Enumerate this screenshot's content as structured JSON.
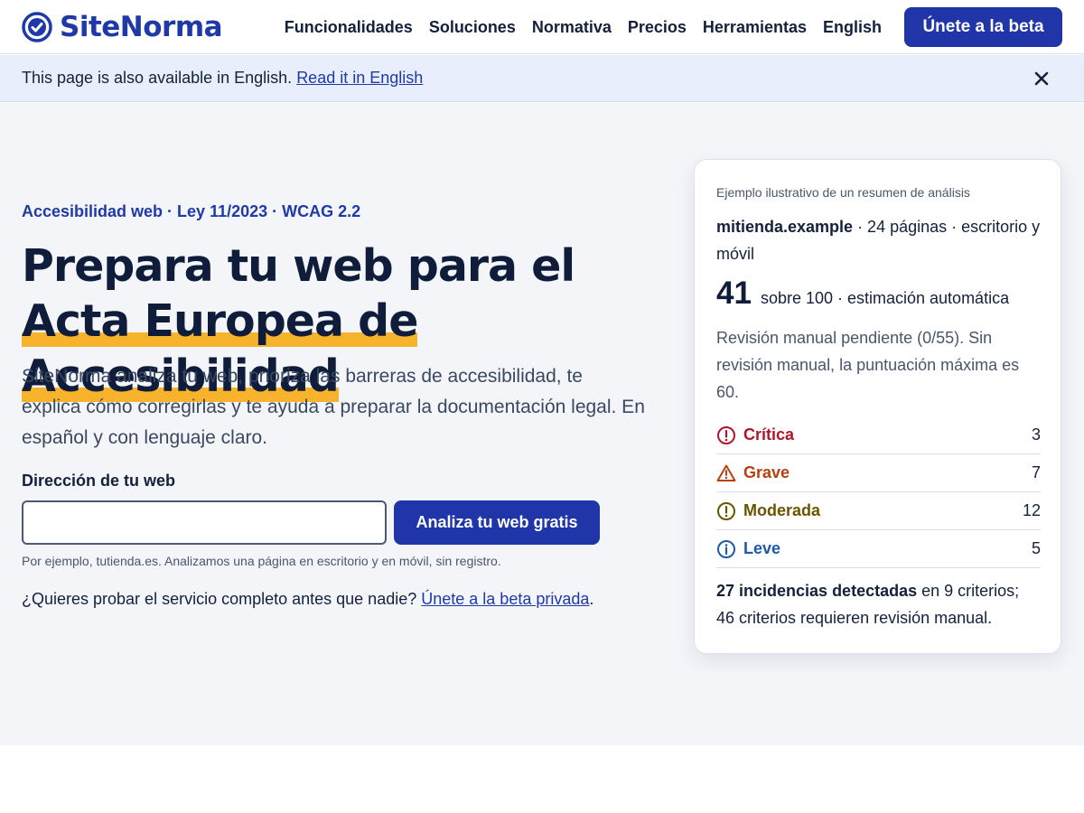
{
  "brand": {
    "name": "SiteNorma",
    "color": "#1f3aa8"
  },
  "nav": {
    "items": [
      "Funcionalidades",
      "Soluciones",
      "Normativa",
      "Precios",
      "Herramientas",
      "English"
    ],
    "cta": "Únete a la beta"
  },
  "banner": {
    "text": "This page is also available in English.",
    "link": "Read it in English",
    "close_icon": "close-icon"
  },
  "hero": {
    "eyebrow": "Accesibilidad web · Ley 11/2023 · WCAG 2.2",
    "headline_part1": "Prepara tu web para el ",
    "headline_highlight": "Acta Europea de Accesibilidad",
    "description": "SiteNorma analiza tu web, prioriza las barreras de accesibilidad, te explica cómo corregirlas y te ayuda a preparar la documentación legal. En español y con lenguaje claro.",
    "field_label": "Dirección de tu web",
    "input_value": "",
    "button": "Analiza tu web gratis",
    "hint": "Por ejemplo, tutienda.es. Analizamos una página en escritorio y en móvil, sin registro.",
    "cta_text": "¿Quieres probar el servicio completo antes que nadie? ",
    "cta_link": "Únete a la beta privada",
    "cta_end": "."
  },
  "card": {
    "caption": "Ejemplo ilustrativo de un resumen de análisis",
    "site": "mitienda.example",
    "site_meta": " · 24 páginas · escritorio y móvil",
    "score": "41",
    "score_rest": "sobre 100 · estimación automática",
    "note": "Revisión manual pendiente (0/55). Sin revisión manual, la puntuación máxima es 60.",
    "severities": [
      {
        "label": "Crítica",
        "count": "3",
        "color": "#b0152b",
        "icon": "critical-icon"
      },
      {
        "label": "Grave",
        "count": "7",
        "color": "#b8400f",
        "icon": "warning-icon"
      },
      {
        "label": "Moderada",
        "count": "12",
        "color": "#6b5400",
        "icon": "moderate-icon"
      },
      {
        "label": "Leve",
        "count": "5",
        "color": "#1f5aa8",
        "icon": "info-icon"
      }
    ],
    "summary_bold": "27 incidencias detectadas",
    "summary_rest": " en 9 criterios; 46 criterios requieren revisión manual."
  },
  "colors": {
    "accent": "#1f35a8",
    "highlight": "#f7b32b",
    "hero_bg": "#f3f5f9",
    "banner_bg": "#e8eefb"
  }
}
